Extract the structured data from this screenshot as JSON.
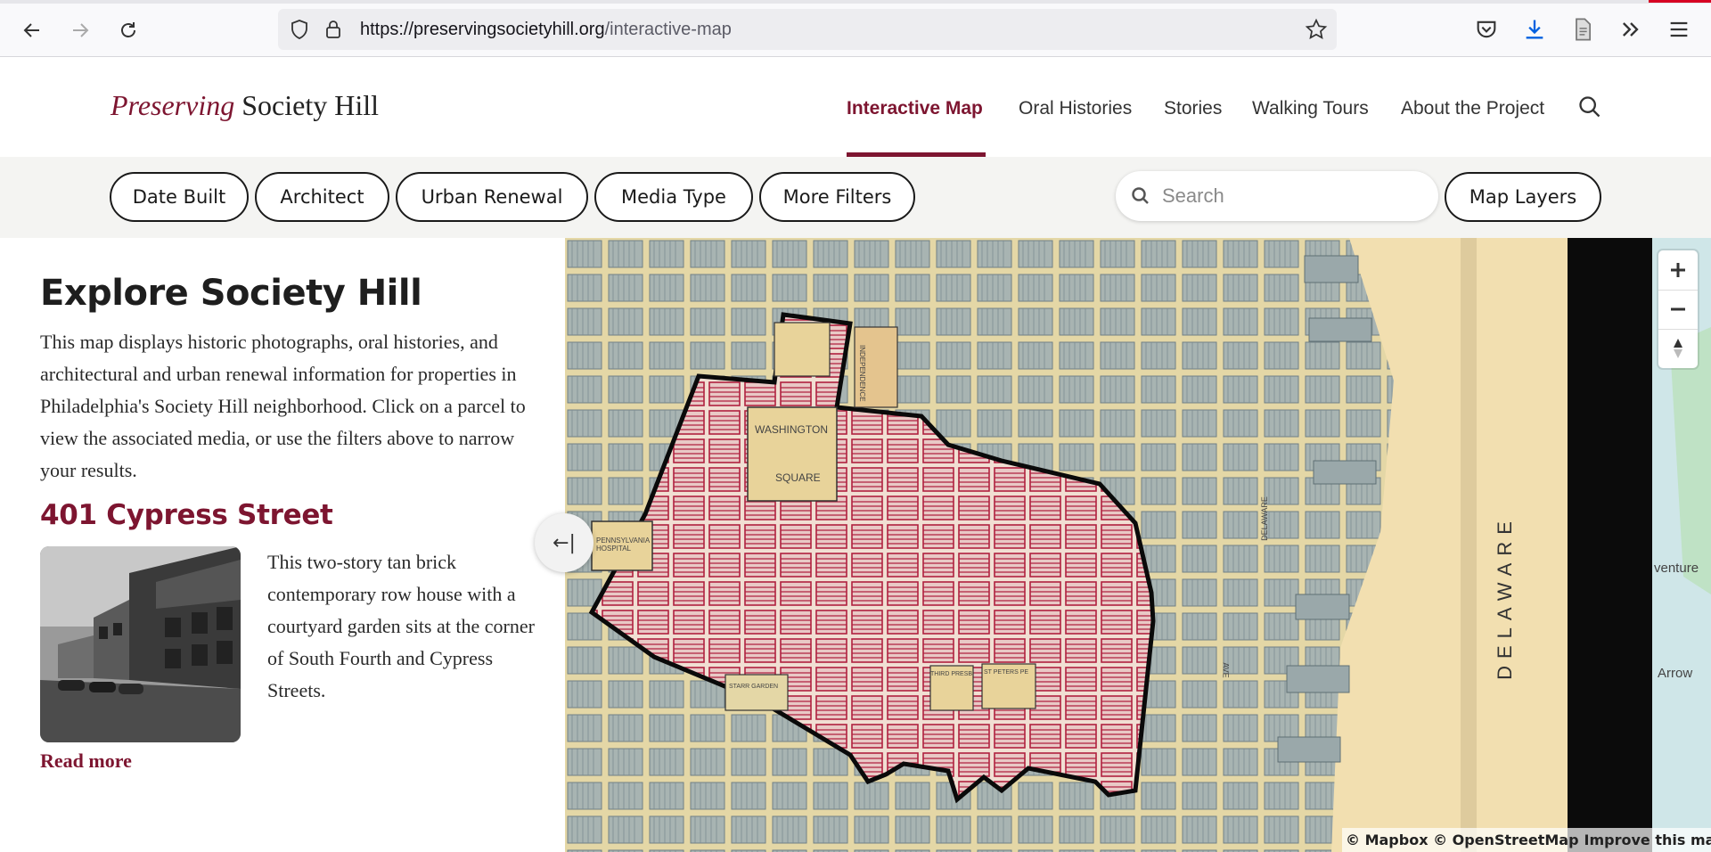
{
  "browser": {
    "url_host": "https://preservingsocietyhill.org",
    "url_path": "/interactive-map"
  },
  "site": {
    "logo_accent": "Preserving",
    "logo_rest": " Society Hill",
    "nav": [
      "Interactive Map",
      "Oral Histories",
      "Stories",
      "Walking Tours",
      "About the Project"
    ],
    "active_nav": "Interactive Map"
  },
  "filters": {
    "pills": [
      "Date Built",
      "Architect",
      "Urban Renewal",
      "Media Type",
      "More Filters"
    ],
    "search_placeholder": "Search",
    "map_layers": "Map Layers"
  },
  "panel": {
    "title": "Explore Society Hill",
    "description": "This map displays historic photographs, oral histories, and architectural and urban renewal information for properties in Philadelphia's Society Hill neighborhood. Click on a parcel to view the associated media, or use the filters above to narrow your results.",
    "property": {
      "title": "401 Cypress Street",
      "description": "This two-story tan brick contemporary row house with a courtyard garden sits at the corner of South Fourth and Cypress Streets.",
      "read_more": "Read more"
    }
  },
  "map": {
    "labels": {
      "delaware": "DELAWARE",
      "washington": "WASHINGTON",
      "square": "SQUARE",
      "independence": "INDEPENDENCE",
      "square2": "SQUARE",
      "pennsylvania_hospital": "PENNSYLVANIA HOSPITAL",
      "delaware_ave": "DELAWARE",
      "ave": "AVE",
      "third_presb": "THIRD PRESB",
      "st_peters": "ST PETERS PE",
      "starr_garden": "STARR GARDEN",
      "side_a": "venture",
      "side_b": "Arrow"
    },
    "collapse_label": "←|",
    "attribution": "© Mapbox © OpenStreetMap",
    "improve": "Improve this map"
  },
  "colors": {
    "brand": "#7d1530",
    "map_paper": "#e7d9a4",
    "parcel_red": "#b0213f"
  }
}
